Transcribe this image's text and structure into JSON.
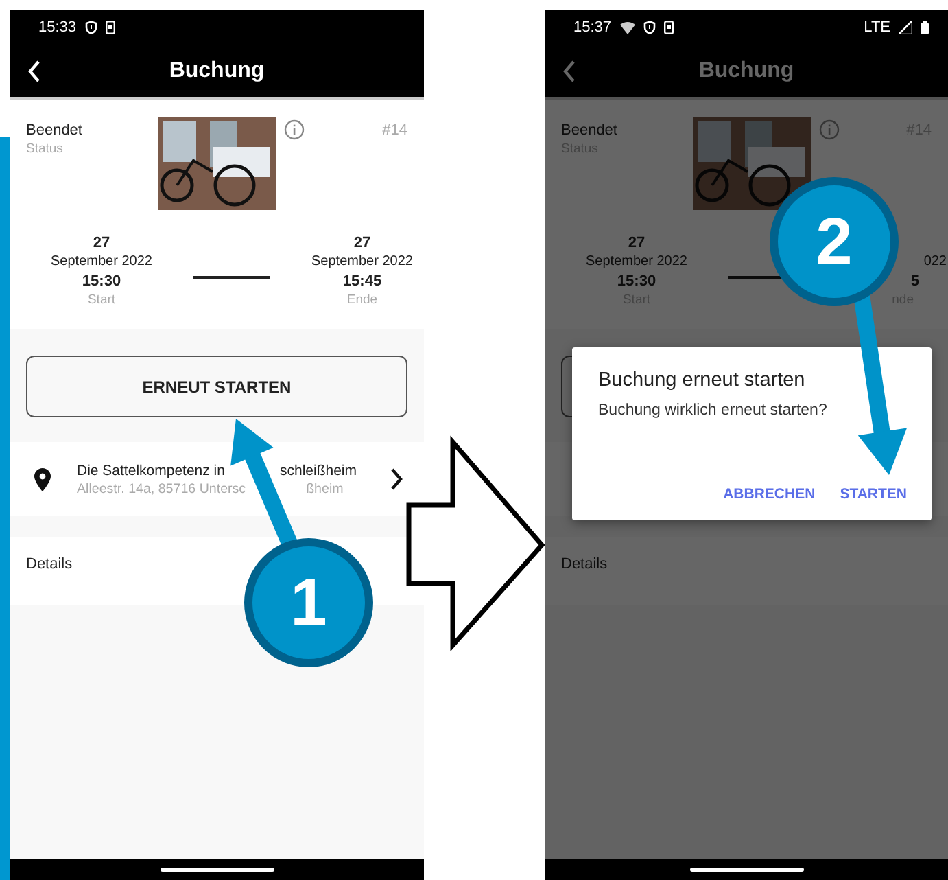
{
  "screens": [
    {
      "dimmed": false,
      "status_bar": {
        "time": "15:33"
      },
      "title": "Buchung",
      "status": "Beendet",
      "status_label": "Status",
      "number": "#14",
      "start": {
        "day": "27",
        "date": "September 2022",
        "time": "15:30",
        "label": "Start"
      },
      "end": {
        "day": "27",
        "date": "September 2022",
        "time": "15:45",
        "label": "Ende"
      },
      "action_button": "ERNEUT STARTEN",
      "location": {
        "name_parts": [
          "Die Sattelkompetenz in",
          "schleißheim"
        ],
        "address_parts": [
          "Alleestr. 14a, 85716 Untersc",
          "ßheim"
        ]
      },
      "details": "Details"
    },
    {
      "dimmed": true,
      "status_bar": {
        "time": "15:37",
        "wifi": true,
        "network": "LTE"
      },
      "title": "Buchung",
      "status": "Beendet",
      "status_label": "Status",
      "number": "#14",
      "start": {
        "day": "27",
        "date": "September 2022",
        "time": "15:30",
        "label": "Start"
      },
      "end": {
        "date": "022",
        "time": "5",
        "label": "nde"
      },
      "details": "Details",
      "dialog": {
        "title": "Buchung erneut starten",
        "message": "Buchung wirklich erneut starten?",
        "buttons": [
          "ABBRECHEN",
          "STARTEN"
        ]
      }
    }
  ],
  "callouts": [
    {
      "number": "1"
    },
    {
      "number": "2"
    }
  ]
}
